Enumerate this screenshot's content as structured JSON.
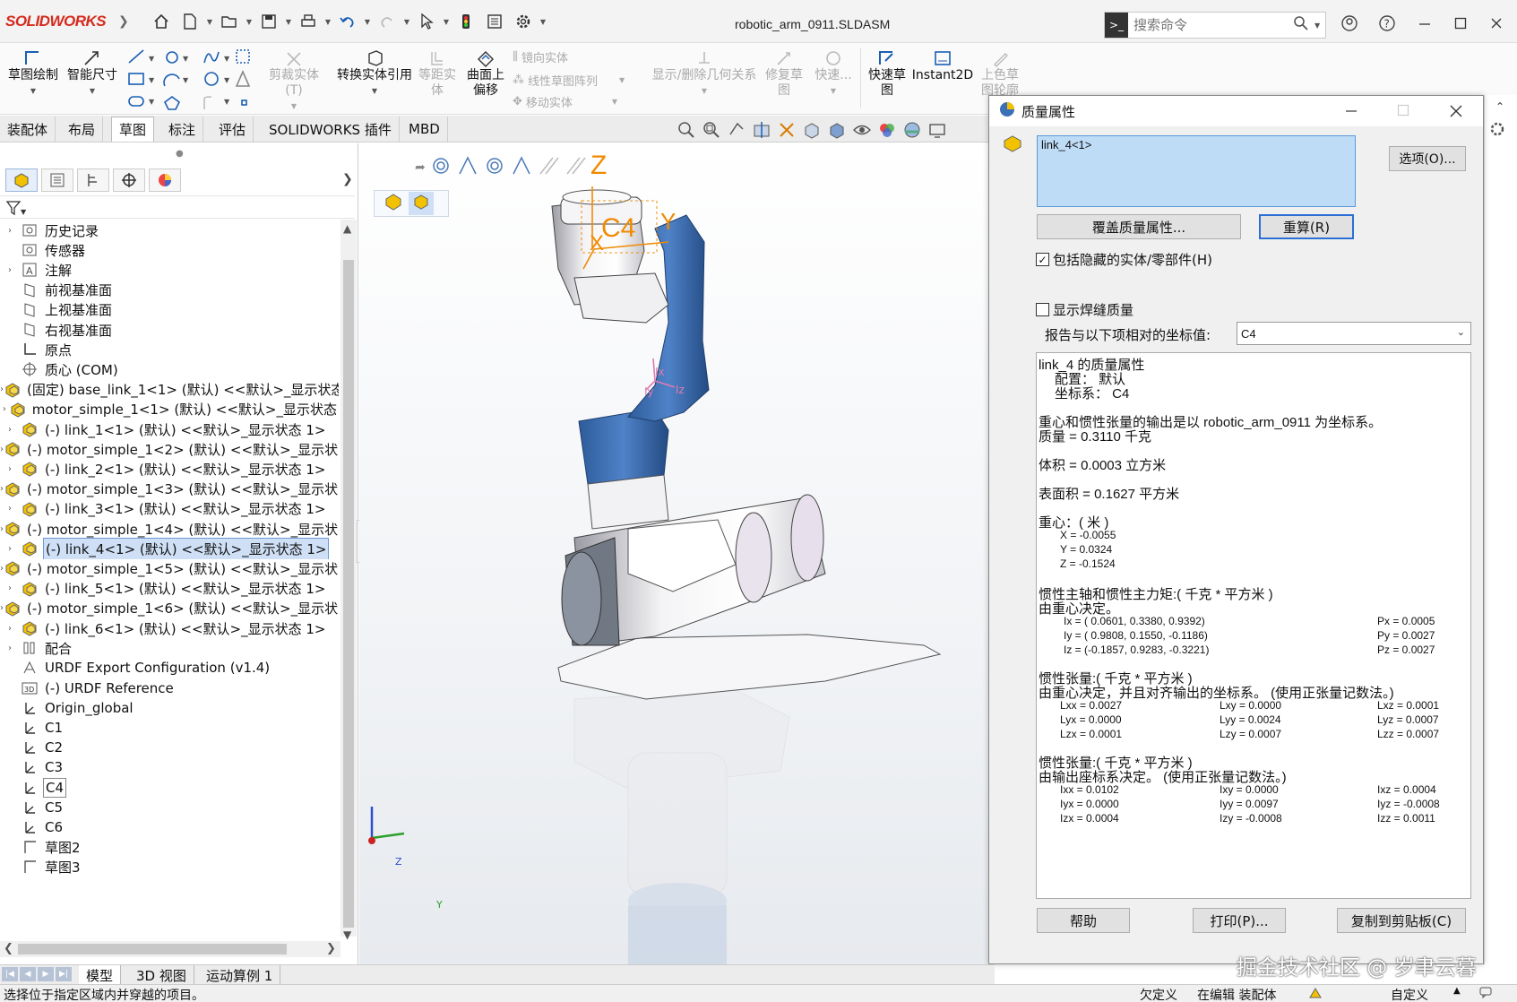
{
  "app": {
    "logo": "SOLIDWORKS",
    "doc_title": "robotic_arm_0911.SLDASM"
  },
  "search": {
    "placeholder": "搜索命令"
  },
  "ribbon": {
    "sketch": "草图绘制",
    "smart_dim": "智能尺寸",
    "trim": "剪裁实体(T)",
    "convert": "转换实体引用",
    "offset_entity_1": "等距实",
    "offset_entity_2": "体",
    "surface_offset_1": "曲面上",
    "surface_offset_2": "偏移",
    "mirror": "镜向实体",
    "linear_pattern": "线性草图阵列",
    "move_entity": "移动实体",
    "display_relations": "显示/删除几何关系",
    "repair_1": "修复草",
    "repair_2": "图",
    "quick_snap": "快速...",
    "rapid_sketch_1": "快速草",
    "rapid_sketch_2": "图",
    "instant2d": "Instant2D",
    "shaded_1": "上色草",
    "shaded_2": "图轮廓"
  },
  "tabs": [
    "装配体",
    "布局",
    "草图",
    "标注",
    "评估",
    "SOLIDWORKS 插件",
    "MBD"
  ],
  "tree": [
    {
      "label": "历史记录",
      "icon": "history-icon",
      "exp": true
    },
    {
      "label": "传感器",
      "icon": "sensor-icon",
      "exp": false
    },
    {
      "label": "注解",
      "icon": "annotation-icon",
      "exp": true
    },
    {
      "label": "前视基准面",
      "icon": "plane-icon",
      "exp": false
    },
    {
      "label": "上视基准面",
      "icon": "plane-icon",
      "exp": false
    },
    {
      "label": "右视基准面",
      "icon": "plane-icon",
      "exp": false
    },
    {
      "label": "原点",
      "icon": "origin-icon",
      "exp": false
    },
    {
      "label": "质心 (COM)",
      "icon": "com-icon",
      "exp": false
    },
    {
      "label": "(固定) base_link_1<1> (默认) <<默认>_显示状态",
      "icon": "part-icon",
      "exp": true
    },
    {
      "label": "motor_simple_1<1> (默认) <<默认>_显示状态",
      "icon": "part-icon",
      "exp": true
    },
    {
      "label": "(-) link_1<1> (默认) <<默认>_显示状态 1>",
      "icon": "part-icon",
      "exp": true
    },
    {
      "label": "(-) motor_simple_1<2> (默认) <<默认>_显示状",
      "icon": "part-icon",
      "exp": true
    },
    {
      "label": "(-) link_2<1> (默认) <<默认>_显示状态 1>",
      "icon": "part-icon",
      "exp": true
    },
    {
      "label": "(-) motor_simple_1<3> (默认) <<默认>_显示状",
      "icon": "part-icon",
      "exp": true
    },
    {
      "label": "(-) link_3<1> (默认) <<默认>_显示状态 1>",
      "icon": "part-icon",
      "exp": true
    },
    {
      "label": "(-) motor_simple_1<4> (默认) <<默认>_显示状",
      "icon": "part-icon",
      "exp": true
    },
    {
      "label": "(-) link_4<1> (默认) <<默认>_显示状态 1>",
      "icon": "part-icon",
      "exp": true
    },
    {
      "label": "(-) motor_simple_1<5> (默认) <<默认>_显示状",
      "icon": "part-icon",
      "exp": true
    },
    {
      "label": "(-) link_5<1> (默认) <<默认>_显示状态 1>",
      "icon": "part-icon",
      "exp": true
    },
    {
      "label": "(-) motor_simple_1<6> (默认) <<默认>_显示状",
      "icon": "part-icon",
      "exp": true
    },
    {
      "label": "(-) link_6<1> (默认) <<默认>_显示状态 1>",
      "icon": "part-icon",
      "exp": true
    },
    {
      "label": "配合",
      "icon": "mate-icon",
      "exp": true
    },
    {
      "label": "URDF Export Configuration (v1.4)",
      "icon": "config-icon",
      "exp": false
    },
    {
      "label": "(-) URDF Reference",
      "icon": "reference-icon",
      "exp": false
    },
    {
      "label": "Origin_global",
      "icon": "coordinate-system-icon",
      "exp": false
    },
    {
      "label": "C1",
      "icon": "coordinate-system-icon",
      "exp": false
    },
    {
      "label": "C2",
      "icon": "coordinate-system-icon",
      "exp": false
    },
    {
      "label": "C3",
      "icon": "coordinate-system-icon",
      "exp": false
    },
    {
      "label": "C4",
      "icon": "coordinate-system-icon",
      "exp": false
    },
    {
      "label": "C5",
      "icon": "coordinate-system-icon",
      "exp": false
    },
    {
      "label": "C6",
      "icon": "coordinate-system-icon",
      "exp": false
    },
    {
      "label": "草图2",
      "icon": "sketch-icon",
      "exp": false
    },
    {
      "label": "草图3",
      "icon": "sketch-icon",
      "exp": false
    }
  ],
  "bottom_tabs": [
    "模型",
    "3D 视图",
    "运动算例 1"
  ],
  "status": {
    "hint": "选择位于指定区域内并穿越的项目。",
    "s1": "欠定义",
    "s2": "在编辑 装配体",
    "s3": "自定义"
  },
  "viewport": {
    "axis_z": "Z",
    "axis_y": "Y",
    "axis_x": "X",
    "csys_label": "C4",
    "ix": "Ix",
    "iy": "Iy",
    "iz": "Iz",
    "triad_z": "Z",
    "triad_y": "Y"
  },
  "dialog": {
    "title": "质量属性",
    "selection": "link_4<1>",
    "options_btn": "选项(O)...",
    "override_btn": "覆盖质量属性...",
    "recalc_btn": "重算(R)",
    "include_hidden": "包括隐藏的实体/零部件(H)",
    "show_weld": "显示焊缝质量",
    "report_relative": "报告与以下项相对的坐标值:",
    "coord_value": "C4",
    "help_btn": "帮助",
    "print_btn": "打印(P)...",
    "copy_btn": "复制到剪贴板(C)"
  },
  "report": {
    "title": "link_4 的质量属性",
    "config": "配置： 默认",
    "csys": "坐标系： C4",
    "note": "重心和惯性张量的输出是以 robotic_arm_0911 为坐标系。",
    "mass": "质量 = 0.3110 千克",
    "volume": "体积 = 0.0003 立方米",
    "area": "表面积 = 0.1627 平方米",
    "cog_title": "重心：( 米 )",
    "cog_x": "X = -0.0055",
    "cog_y": "Y = 0.0324",
    "cog_z": "Z = -0.1524",
    "pa_title": "惯性主轴和惯性主力矩:( 千克 * 平方米 )",
    "pa_sub": "由重心决定。",
    "ix": "Ix = ( 0.0601,  0.3380,  0.9392)",
    "iy": "Iy = ( 0.9808,  0.1550, -0.1186)",
    "iz": "Iz = (-0.1857,  0.9283, -0.3221)",
    "px": "Px = 0.0005",
    "py": "Py = 0.0027",
    "pz": "Pz = 0.0027",
    "it1_title": "惯性张量:( 千克 * 平方米 )",
    "it1_sub": "由重心决定，并且对齐输出的坐标系。 (使用正张量记数法。)",
    "it1": [
      [
        "Lxx = 0.0027",
        "Lxy = 0.0000",
        "Lxz = 0.0001"
      ],
      [
        "Lyx = 0.0000",
        "Lyy = 0.0024",
        "Lyz = 0.0007"
      ],
      [
        "Lzx = 0.0001",
        "Lzy = 0.0007",
        "Lzz = 0.0007"
      ]
    ],
    "it2_title": "惯性张量:( 千克 * 平方米 )",
    "it2_sub": "由输出座标系决定。 (使用正张量记数法。)",
    "it2": [
      [
        "Ixx = 0.0102",
        "Ixy = 0.0000",
        "Ixz = 0.0004"
      ],
      [
        "Iyx = 0.0000",
        "Iyy = 0.0097",
        "Iyz = -0.0008"
      ],
      [
        "Izx = 0.0004",
        "Izy = -0.0008",
        "Izz = 0.0011"
      ]
    ]
  },
  "watermark": "掘金技术社区 @ 岁聿云暮"
}
